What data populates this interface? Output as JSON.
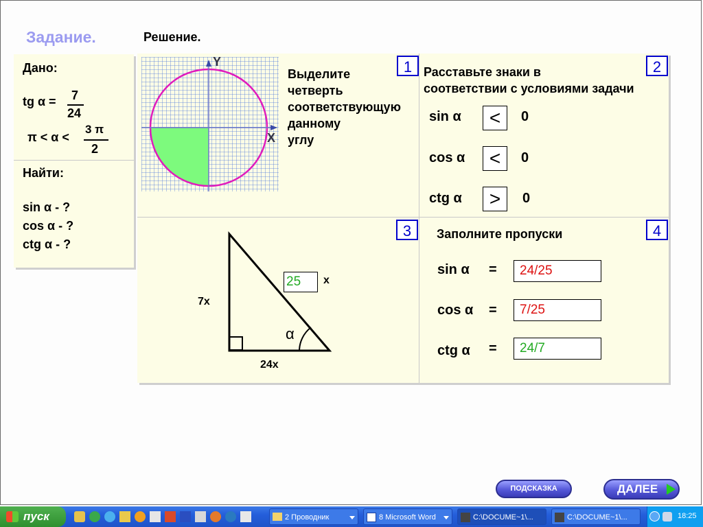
{
  "header": {
    "task_title": "Задание.",
    "solution_title": "Решение."
  },
  "given": {
    "title": "Дано:",
    "tg_label": "tg α =",
    "tg_num": "7",
    "tg_den": "24",
    "ineq_left": "π < α <",
    "ineq_num": "3 π",
    "ineq_den": "2",
    "find_title": "Найти:",
    "find_items": [
      "sin α - ?",
      "cos α - ?",
      "ctg α - ?"
    ]
  },
  "panel1": {
    "number": "1",
    "text_lines": [
      "Выделите",
      "четверть",
      "соответствующую",
      "данному",
      "углу"
    ],
    "axis_y": "Y",
    "axis_x": "X"
  },
  "panel2": {
    "number": "2",
    "title_lines": [
      "Расставьте знаки в",
      "соответствии с условиями задачи"
    ],
    "rows": [
      {
        "func": "sin α",
        "sign": "<",
        "value": "0"
      },
      {
        "func": "cos α",
        "sign": "<",
        "value": "0"
      },
      {
        "func": "ctg α",
        "sign": ">",
        "value": "0"
      }
    ]
  },
  "panel3": {
    "number": "3",
    "left_leg": "7x",
    "bottom_leg": "24x",
    "hyp_value": "25",
    "hyp_unit": "x",
    "angle": "α"
  },
  "panel4": {
    "number": "4",
    "title": "Заполните пропуски",
    "rows": [
      {
        "func": "sin α",
        "eq": "=",
        "answer": "24/25",
        "color": "#dd1111"
      },
      {
        "func": "cos α",
        "eq": "=",
        "answer": "7/25",
        "color": "#dd1111"
      },
      {
        "func": "ctg α",
        "eq": "=",
        "answer": "24/7",
        "color": "#22aa22"
      }
    ]
  },
  "buttons": {
    "hint": "ПОДСКАЗКА",
    "next": "ДАЛЕЕ"
  },
  "taskbar": {
    "start": "пуск",
    "items": [
      "2 Проводник",
      "8 Microsoft Word",
      "C:\\DOCUME~1\\...",
      "C:\\DOCUME~1\\..."
    ],
    "clock": "18:25"
  },
  "colors": {
    "accent_blue": "#0000cc",
    "title_lavender": "#9b9bf0",
    "panel_bg": "#fdfde6",
    "quarter_green": "#7dfa7d",
    "circle_magenta": "#e01cbc",
    "answer_green": "#22aa22"
  }
}
